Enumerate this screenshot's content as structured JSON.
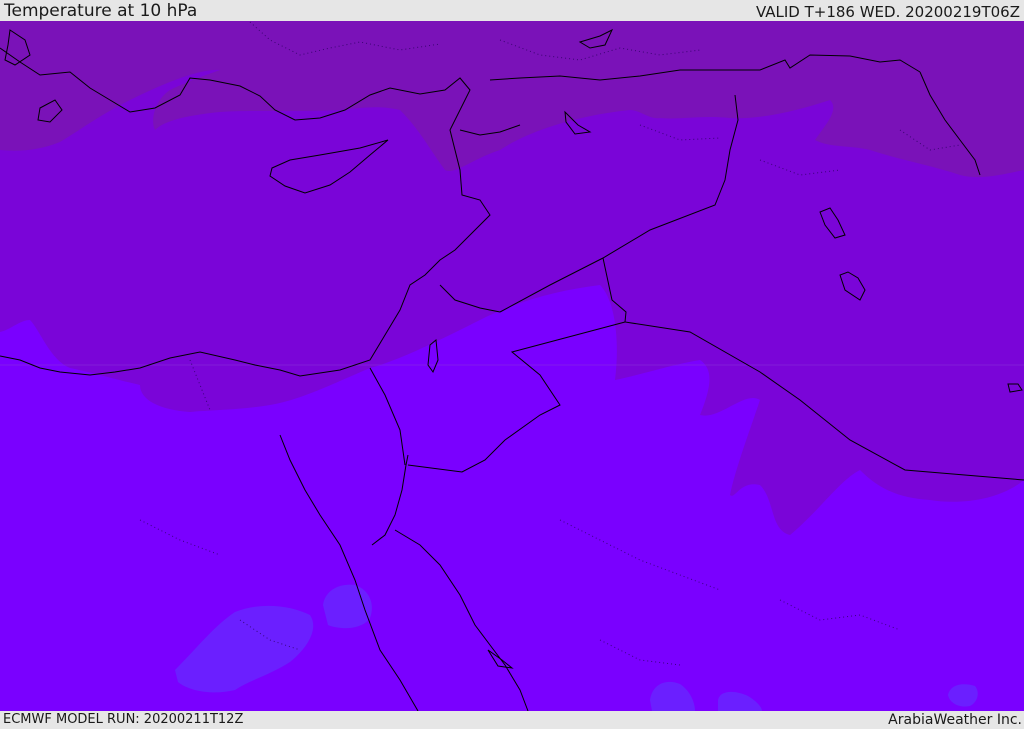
{
  "header": {
    "title": "Temperature at 10 hPa",
    "valid": "VALID T+186 WED. 20200219T06Z"
  },
  "footer": {
    "model_run": "ECMWF MODEL RUN: 20200211T12Z",
    "credit": "ArabiaWeather Inc."
  },
  "colors": {
    "dark_purple": "#7a12b8",
    "mid_purple": "#7a05d8",
    "violet": "#7a00ff",
    "blue_violet": "#6b1fff",
    "coast_line": "#000000",
    "border_line": "#000000"
  }
}
